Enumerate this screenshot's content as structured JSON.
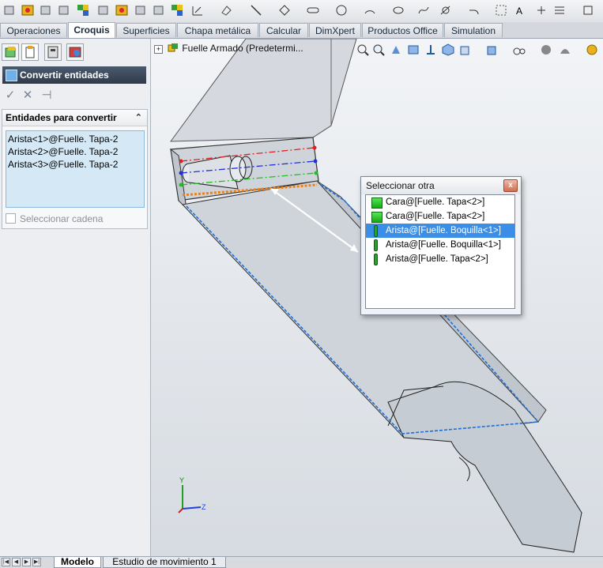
{
  "command_tabs": [
    {
      "label": "Operaciones",
      "active": false
    },
    {
      "label": "Croquis",
      "active": true
    },
    {
      "label": "Superficies",
      "active": false
    },
    {
      "label": "Chapa metálica",
      "active": false
    },
    {
      "label": "Calcular",
      "active": false
    },
    {
      "label": "DimXpert",
      "active": false
    },
    {
      "label": "Productos Office",
      "active": false
    },
    {
      "label": "Simulation",
      "active": false
    }
  ],
  "property_manager": {
    "title": "Convertir entidades",
    "group_title": "Entidades para convertir",
    "entities": [
      "Arista<1>@Fuelle. Tapa-2",
      "Arista<2>@Fuelle. Tapa-2",
      "Arista<3>@Fuelle. Tapa-2"
    ],
    "chain_label": "Seleccionar cadena"
  },
  "viewport": {
    "tree_label": "Fuelle Armado  (Predetermi..."
  },
  "select_other": {
    "title": "Seleccionar otra",
    "close_label": "x",
    "items": [
      {
        "label": "Cara@[Fuelle. Tapa<2>]",
        "icon": "face-icon",
        "selected": false
      },
      {
        "label": "Cara@[Fuelle. Tapa<2>]",
        "icon": "face-icon",
        "selected": false
      },
      {
        "label": "Arista@[Fuelle. Boquilla<1>]",
        "icon": "edge-icon",
        "selected": true
      },
      {
        "label": "Arista@[Fuelle. Boquilla<1>]",
        "icon": "edge-icon",
        "selected": false
      },
      {
        "label": "Arista@[Fuelle. Tapa<2>]",
        "icon": "edge-icon",
        "selected": false
      }
    ]
  },
  "triad": {
    "y": "Y",
    "z": "Z"
  },
  "bottom_tabs": [
    {
      "label": "Modelo",
      "active": true
    },
    {
      "label": "Estudio de movimiento 1",
      "active": false
    }
  ],
  "colors": {
    "selection": "#3a8ee6",
    "title_bar": "#2f3b4b",
    "face_icon": "#22c022",
    "edge_highlight_red": "#e02020",
    "edge_highlight_blue": "#2030e0",
    "edge_highlight_green": "#20c020",
    "edge_highlight_orange": "#f08010",
    "dashed_edge": "#1f6fd6"
  }
}
